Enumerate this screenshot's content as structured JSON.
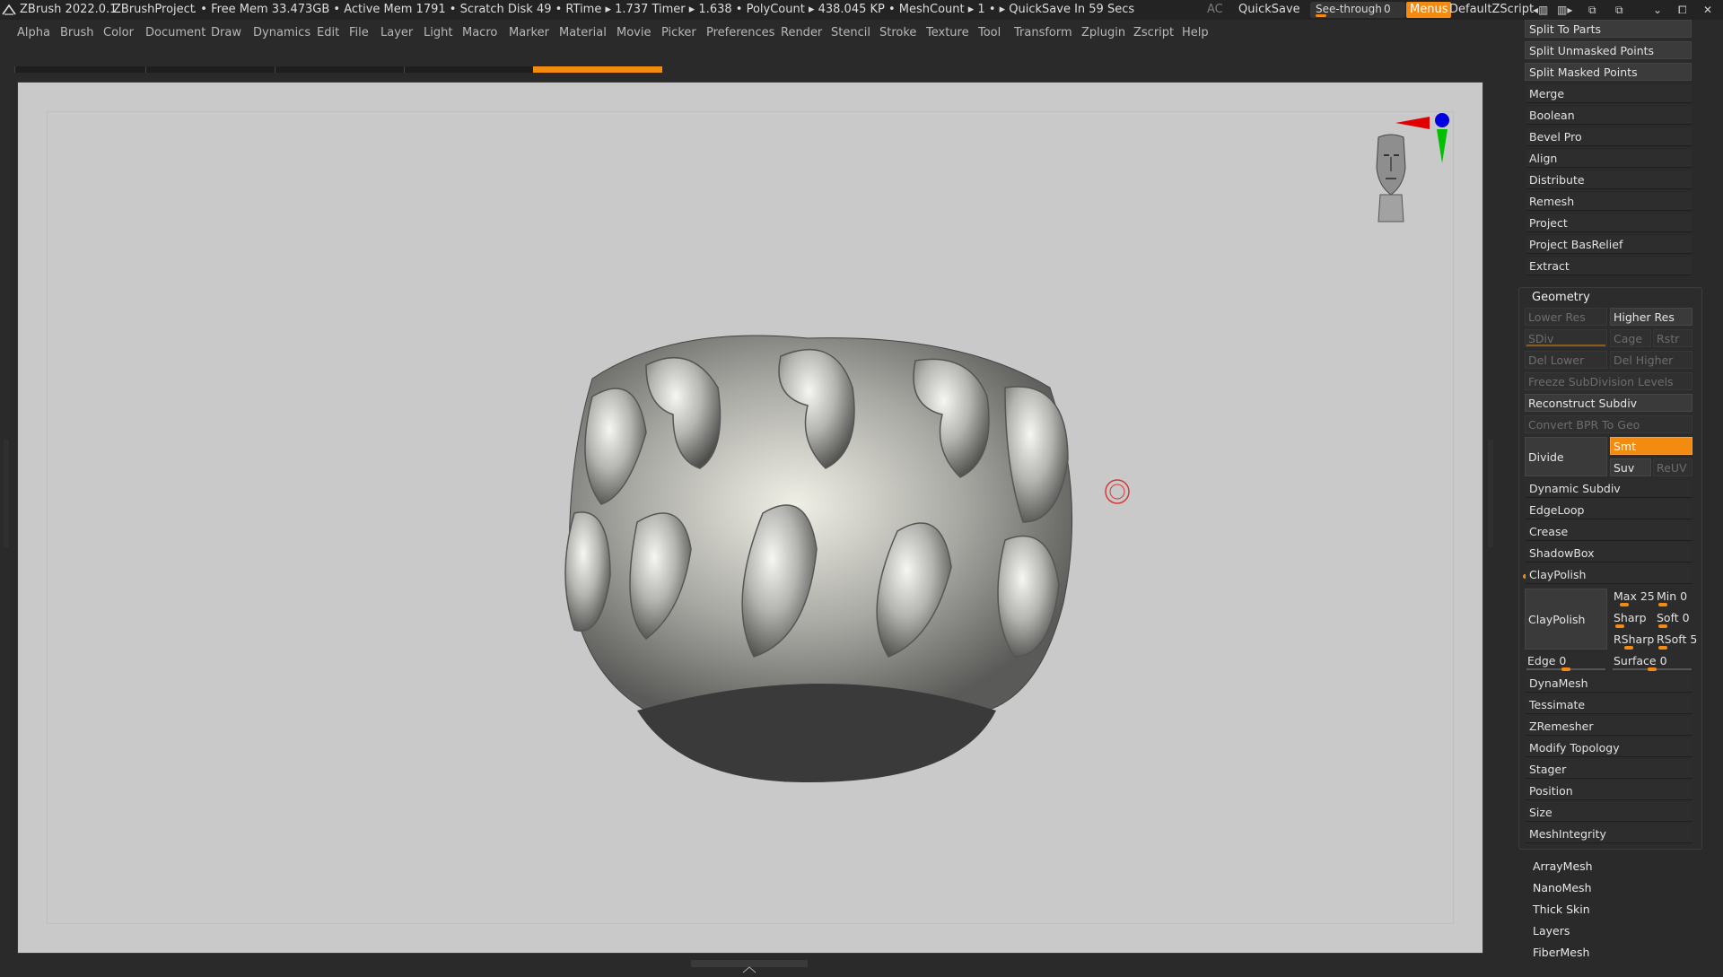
{
  "titlebar": {
    "app": "ZBrush 2022.0.1",
    "project": "ZBrushProject",
    "stats": ". • Free Mem 33.473GB • Active Mem 1791 • Scratch Disk 49 • RTime ▸ 1.737 Timer ▸ 1.638 • PolyCount ▸ 438.045 KP • MeshCount ▸ 1 • ▸ QuickSave In 59 Secs",
    "ac": "AC",
    "quicksave": "QuickSave",
    "seethrough_label": "See-through",
    "seethrough_value": "0",
    "menus": "Menus",
    "script": "DefaultZScript",
    "seethrough_level": 0
  },
  "menubar": {
    "items": [
      "Alpha",
      "Brush",
      "Color",
      "Document",
      "Draw",
      "Dynamics",
      "Edit",
      "File",
      "Layer",
      "Light",
      "Macro",
      "Marker",
      "Material",
      "Movie",
      "Picker",
      "Preferences",
      "Render",
      "Stencil",
      "Stroke",
      "Texture",
      "Tool",
      "Transform",
      "Zplugin",
      "Zscript",
      "Help"
    ]
  },
  "colors": {
    "accent": "#f28b10",
    "viewport_bg": "#c9c9c9",
    "panel_bg": "#2c2c2c",
    "axis_x": "#e00000",
    "axis_y": "#00c000",
    "axis_z": "#0000e0"
  },
  "panel": {
    "split_to_parts": "Split To Parts",
    "split_unmasked": "Split Unmasked Points",
    "split_masked": "Split Masked Points",
    "subtool_items": [
      "Merge",
      "Boolean",
      "Bevel Pro",
      "Align",
      "Distribute",
      "Remesh",
      "Project",
      "Project BasRelief",
      "Extract"
    ],
    "geometry": {
      "title": "Geometry",
      "lower_res": "Lower Res",
      "higher_res": "Higher Res",
      "sdiv": "SDiv",
      "cage": "Cage",
      "rstr": "Rstr",
      "del_lower": "Del Lower",
      "del_higher": "Del Higher",
      "freeze": "Freeze SubDivision Levels",
      "reconstruct": "Reconstruct Subdiv",
      "convert_bpr": "Convert BPR To Geo",
      "divide": "Divide",
      "smt": "Smt",
      "suv": "Suv",
      "reuv": "ReUV",
      "dynamic_subdiv": "Dynamic Subdiv",
      "edgeloop": "EdgeLoop",
      "crease": "Crease",
      "shadowbox": "ShadowBox",
      "claypolish_header": "ClayPolish",
      "claypolish_btn": "ClayPolish",
      "max": "Max 25",
      "min": "Min 0",
      "sharp": "Sharp",
      "soft": "Soft 0",
      "rsharp": "RSharp",
      "rsoft": "RSoft 5",
      "edge": "Edge 0",
      "surface": "Surface 0",
      "after_items": [
        "DynaMesh",
        "Tessimate",
        "ZRemesher",
        "Modify Topology",
        "Stager",
        "Position",
        "Size",
        "MeshIntegrity"
      ]
    },
    "lower_items": [
      "ArrayMesh",
      "NanoMesh",
      "Thick Skin",
      "Layers",
      "FiberMesh"
    ]
  }
}
